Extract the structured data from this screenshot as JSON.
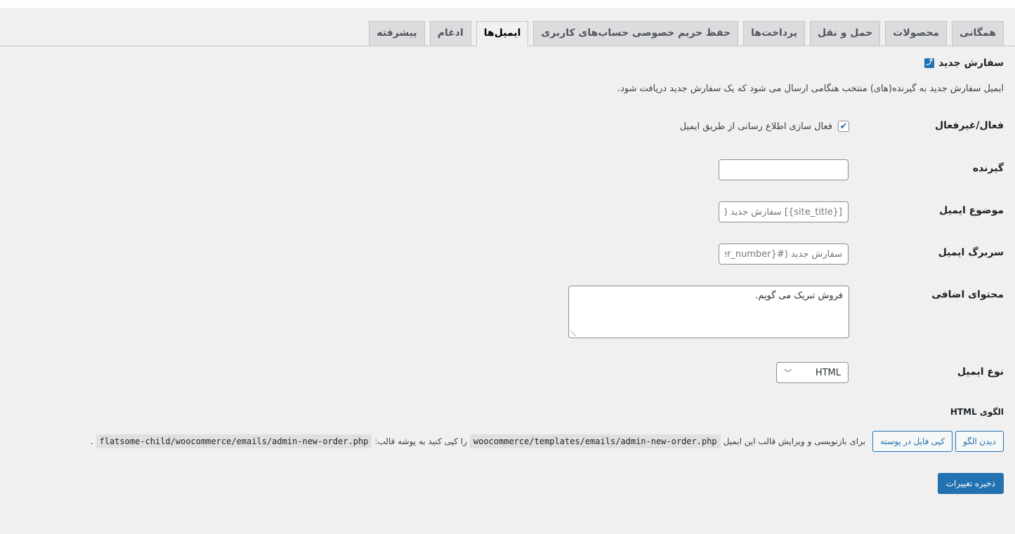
{
  "tabs": [
    {
      "label": "همگانی"
    },
    {
      "label": "محصولات"
    },
    {
      "label": "حمل و نقل"
    },
    {
      "label": "پرداخت‌ها"
    },
    {
      "label": "حفظ حریم خصوصی حساب‌های کاربری"
    },
    {
      "label": "ایمیل‌ها"
    },
    {
      "label": "ادغام"
    },
    {
      "label": "پیشرفته"
    }
  ],
  "active_tab": "ایمیل‌ها",
  "section": {
    "title": "سفارش جدید",
    "back_icon": "return-icon",
    "description": "ایمیل سفارش جدید به گیرنده(های) منتخب هنگامی ارسال می شود که یک سفارش جدید دریافت شود."
  },
  "fields": {
    "enable": {
      "label": "فعال/غیرفعال",
      "checkbox_label": "فعال سازی اطلاع رسانی از طریق ایمیل",
      "checked": true
    },
    "recipient": {
      "label": "گیرنده",
      "value": ""
    },
    "subject": {
      "label": "موضوع ایمیل",
      "placeholder": "[{site_title}] سفارش جدید (#{order_number})"
    },
    "heading": {
      "label": "سربرگ ایمیل",
      "placeholder": "سفارش جدید (#{order_number})"
    },
    "additional": {
      "label": "محتوای اضافی",
      "value": "فروش تبریک می گویم."
    },
    "email_type": {
      "label": "نوع ایمیل",
      "selected": "HTML"
    }
  },
  "template": {
    "heading": "الگوی HTML",
    "view_button": "دیدن الگو",
    "copy_button": "کپی فایل در پوسته",
    "text_before": "برای بازنویسی و ویرایش قالب این ایمیل",
    "source_path": "woocommerce/templates/emails/admin-new-order.php",
    "text_middle": "را کپی کنید به پوشه قالب:",
    "target_path": "flatsome-child/woocommerce/emails/admin-new-order.php",
    "text_end": "."
  },
  "save_button": "ذخیره تغییرات",
  "colors": {
    "accent": "#2271b1",
    "background": "#f0f0f1",
    "tab_inactive": "#dcdcde"
  }
}
